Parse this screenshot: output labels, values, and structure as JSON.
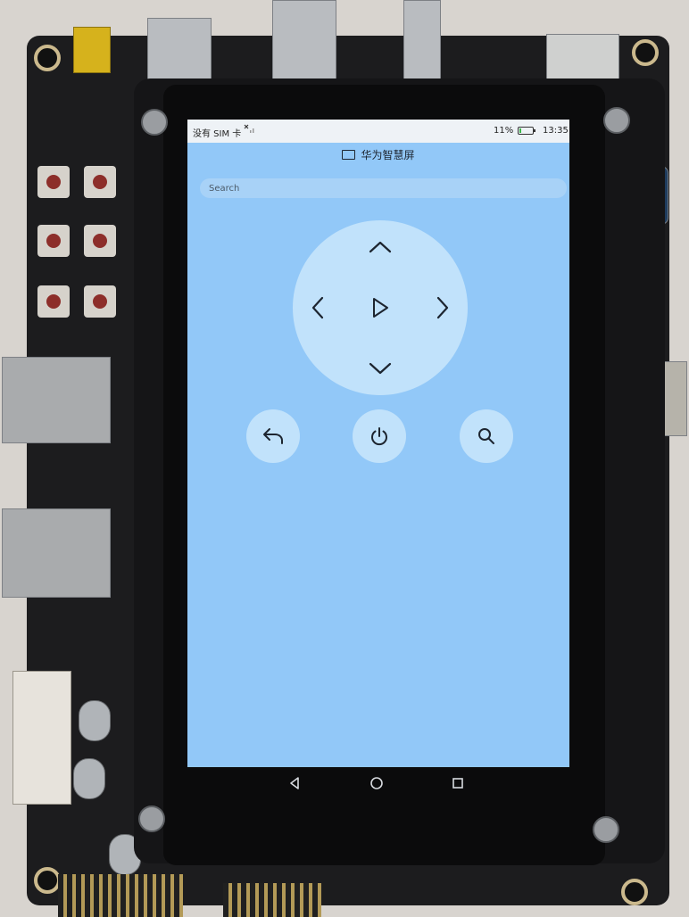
{
  "status_bar": {
    "carrier": "没有 SIM 卡",
    "signal_icon": "no-signal-icon",
    "battery_percent": "11%",
    "battery_level": 0.11,
    "time": "13:35"
  },
  "title_bar": {
    "title": "华为智慧屏",
    "icon": "tv-icon"
  },
  "search": {
    "placeholder": "Search"
  },
  "remote": {
    "dpad_buttons": [
      "up",
      "down",
      "left",
      "right",
      "ok"
    ],
    "action_buttons": [
      "back",
      "power",
      "search"
    ]
  },
  "nav_bar": {
    "buttons": [
      "back",
      "home",
      "recents"
    ]
  },
  "colors": {
    "screen_background": "#92c8f8",
    "button_fill": "#c1e2fb",
    "icon_stroke": "#1d2530"
  }
}
